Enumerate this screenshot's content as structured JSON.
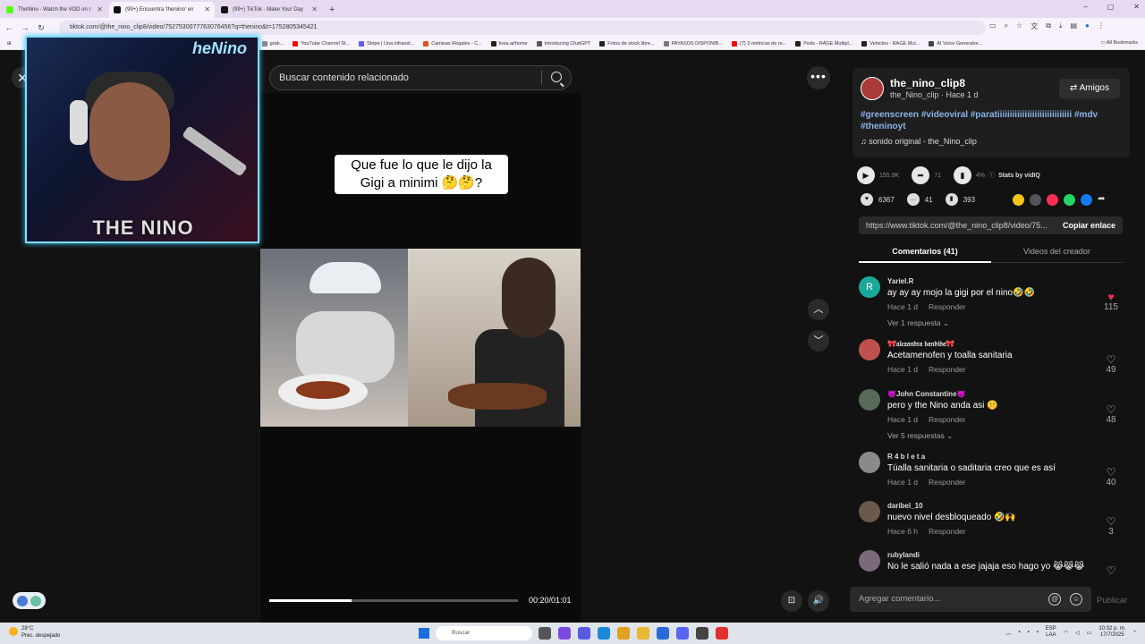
{
  "browser": {
    "tabs": [
      {
        "title": "TheNino - Watch the VOD on r",
        "color": "#53fc18"
      },
      {
        "title": "(99+) Encuentra 'theniino' en",
        "color": "#111111",
        "active": true
      },
      {
        "title": "(99+) TikTok - Make Your Day",
        "color": "#111111"
      }
    ],
    "new_tab": "+",
    "url": "tiktok.com/@the_nino_clip8/video/7527530077763076456?q=thenino&t=1752805345421",
    "bookmarks": [
      {
        "label": "grab...",
        "color": "#888888"
      },
      {
        "label": "YouTube Channel St...",
        "color": "#ff0000"
      },
      {
        "label": "Stripe | Una infraest...",
        "color": "#635bff"
      },
      {
        "label": "Camisas Regales - C...",
        "color": "#e05020"
      },
      {
        "label": "krea.ai/home",
        "color": "#222222"
      },
      {
        "label": "Introducing ChatGPT",
        "color": "#555555"
      },
      {
        "label": "Fotos de stock libre...",
        "color": "#222222"
      },
      {
        "label": "PAYASOS DISPONIB...",
        "color": "#777777"
      },
      {
        "label": "(7) 3 métricas de re...",
        "color": "#ff0000"
      },
      {
        "label": "Peds - RAGE Multipl...",
        "color": "#222222"
      },
      {
        "label": "Vehicles - RAGE Mul...",
        "color": "#222222"
      },
      {
        "label": "AI Voice Generator...",
        "color": "#444444"
      }
    ],
    "all_bookmarks": "All Bookmarks"
  },
  "webcam": {
    "logo_text": "THE NINO",
    "corner_text": "heNino"
  },
  "search": {
    "placeholder": "Buscar contenido relacionado"
  },
  "video": {
    "caption": "Que fue lo que le dijo la Gigi a minimi 🤔🤔?",
    "time": "00:20/01:01",
    "progress": 0.33
  },
  "author": {
    "username": "the_nino_clip8",
    "subtitle": "the_Nino_clip · Hace 1 d",
    "friends_label": "Amigos",
    "hashtags": "#greenscreen #videoviral #paratiiiiiiiiiiiiiiiiiiiiiiiiiiiiii #mdv #theninoyt",
    "sound": "sonido original - the_Nino_clip"
  },
  "stats": {
    "views": "155.9K",
    "shares": "71",
    "percent": "4%",
    "by": "Stats by vidIQ"
  },
  "actions": {
    "likes": "6367",
    "comments": "41",
    "saves": "393"
  },
  "share_colors": [
    "#f5c518",
    "#555555",
    "#fe2c55",
    "#25d366",
    "#1877f2",
    "#dddddd"
  ],
  "link": {
    "url": "https://www.tiktok.com/@the_nino_clip8/video/75...",
    "copy_label": "Copiar enlace"
  },
  "tabs": {
    "comments": "Comentarios (41)",
    "videos": "Videos del creador"
  },
  "comments": [
    {
      "user": "Yariel.R",
      "text": "ay ay ay mojo la gigi por el nino🤣🤣",
      "time": "Hace 1 d",
      "reply": "Responder",
      "likes": "115",
      "liked": true,
      "replies": "Ver 1 respuesta ⌄",
      "avatar_color": "#1aa89a",
      "avatar_letter": "R"
    },
    {
      "user": "🎀𝔞𝔩𝔢𝔵𝔞𝔫𝔡𝔯𝔞 𝔟𝔞𝔫𝔡𝔦𝔡𝔞🎀",
      "text": "Acetamenofen y toalla sanitaria",
      "time": "Hace 1 d",
      "reply": "Responder",
      "likes": "49",
      "liked": false,
      "replies": "",
      "avatar_color": "#c05050",
      "avatar_letter": ""
    },
    {
      "user": "👿John Constantine👿",
      "text": "pero y the Nino anda asi 🤫",
      "time": "Hace 1 d",
      "reply": "Responder",
      "likes": "48",
      "liked": false,
      "replies": "Ver 5 respuestas ⌄",
      "avatar_color": "#5a6a5a",
      "avatar_letter": ""
    },
    {
      "user": "R 4 b l e t a",
      "text": "Túalla sanitaria o saditaria creo que es así",
      "time": "Hace 1 d",
      "reply": "Responder",
      "likes": "40",
      "liked": false,
      "replies": "",
      "avatar_color": "#8a8a8a",
      "avatar_letter": ""
    },
    {
      "user": "daribel_10",
      "text": "nuevo nivel desbloqueado 🤣🙌",
      "time": "Hace 6 h",
      "reply": "Responder",
      "likes": "3",
      "liked": false,
      "replies": "",
      "avatar_color": "#6a5a4a",
      "avatar_letter": ""
    },
    {
      "user": "rubylandi",
      "text": "No le salió nada a ese jajaja eso hago yo 😹😹😹",
      "time": "",
      "reply": "",
      "likes": "",
      "liked": false,
      "replies": "",
      "avatar_color": "#7a6a7a",
      "avatar_letter": ""
    }
  ],
  "comment_input": {
    "placeholder": "Agregar comentario...",
    "publish": "Publicar"
  },
  "taskbar": {
    "temp": "28°C",
    "weather": "Prec. despejado",
    "search": "Buscar",
    "lang1": "ESP",
    "lang2": "LAA",
    "time": "10:32 p. m.",
    "date": "17/7/2025"
  }
}
